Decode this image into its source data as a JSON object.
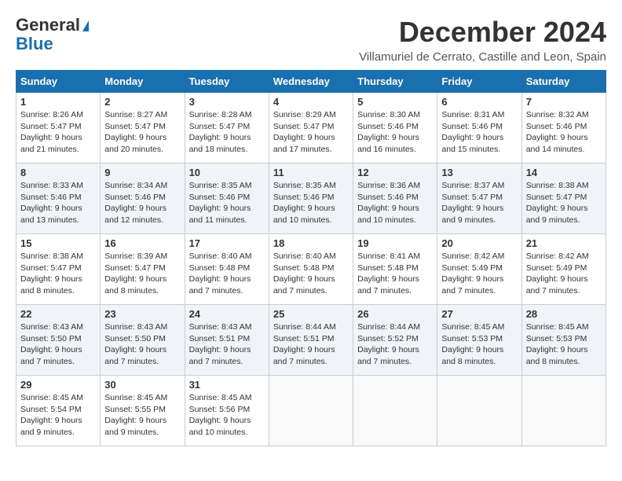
{
  "logo": {
    "line1": "General",
    "line2": "Blue"
  },
  "title": "December 2024",
  "subtitle": "Villamuriel de Cerrato, Castille and Leon, Spain",
  "days_of_week": [
    "Sunday",
    "Monday",
    "Tuesday",
    "Wednesday",
    "Thursday",
    "Friday",
    "Saturday"
  ],
  "weeks": [
    [
      {
        "day": "1",
        "detail": "Sunrise: 8:26 AM\nSunset: 5:47 PM\nDaylight: 9 hours and 21 minutes."
      },
      {
        "day": "2",
        "detail": "Sunrise: 8:27 AM\nSunset: 5:47 PM\nDaylight: 9 hours and 20 minutes."
      },
      {
        "day": "3",
        "detail": "Sunrise: 8:28 AM\nSunset: 5:47 PM\nDaylight: 9 hours and 18 minutes."
      },
      {
        "day": "4",
        "detail": "Sunrise: 8:29 AM\nSunset: 5:47 PM\nDaylight: 9 hours and 17 minutes."
      },
      {
        "day": "5",
        "detail": "Sunrise: 8:30 AM\nSunset: 5:46 PM\nDaylight: 9 hours and 16 minutes."
      },
      {
        "day": "6",
        "detail": "Sunrise: 8:31 AM\nSunset: 5:46 PM\nDaylight: 9 hours and 15 minutes."
      },
      {
        "day": "7",
        "detail": "Sunrise: 8:32 AM\nSunset: 5:46 PM\nDaylight: 9 hours and 14 minutes."
      }
    ],
    [
      {
        "day": "8",
        "detail": "Sunrise: 8:33 AM\nSunset: 5:46 PM\nDaylight: 9 hours and 13 minutes."
      },
      {
        "day": "9",
        "detail": "Sunrise: 8:34 AM\nSunset: 5:46 PM\nDaylight: 9 hours and 12 minutes."
      },
      {
        "day": "10",
        "detail": "Sunrise: 8:35 AM\nSunset: 5:46 PM\nDaylight: 9 hours and 11 minutes."
      },
      {
        "day": "11",
        "detail": "Sunrise: 8:35 AM\nSunset: 5:46 PM\nDaylight: 9 hours and 10 minutes."
      },
      {
        "day": "12",
        "detail": "Sunrise: 8:36 AM\nSunset: 5:46 PM\nDaylight: 9 hours and 10 minutes."
      },
      {
        "day": "13",
        "detail": "Sunrise: 8:37 AM\nSunset: 5:47 PM\nDaylight: 9 hours and 9 minutes."
      },
      {
        "day": "14",
        "detail": "Sunrise: 8:38 AM\nSunset: 5:47 PM\nDaylight: 9 hours and 9 minutes."
      }
    ],
    [
      {
        "day": "15",
        "detail": "Sunrise: 8:38 AM\nSunset: 5:47 PM\nDaylight: 9 hours and 8 minutes."
      },
      {
        "day": "16",
        "detail": "Sunrise: 8:39 AM\nSunset: 5:47 PM\nDaylight: 9 hours and 8 minutes."
      },
      {
        "day": "17",
        "detail": "Sunrise: 8:40 AM\nSunset: 5:48 PM\nDaylight: 9 hours and 7 minutes."
      },
      {
        "day": "18",
        "detail": "Sunrise: 8:40 AM\nSunset: 5:48 PM\nDaylight: 9 hours and 7 minutes."
      },
      {
        "day": "19",
        "detail": "Sunrise: 8:41 AM\nSunset: 5:48 PM\nDaylight: 9 hours and 7 minutes."
      },
      {
        "day": "20",
        "detail": "Sunrise: 8:42 AM\nSunset: 5:49 PM\nDaylight: 9 hours and 7 minutes."
      },
      {
        "day": "21",
        "detail": "Sunrise: 8:42 AM\nSunset: 5:49 PM\nDaylight: 9 hours and 7 minutes."
      }
    ],
    [
      {
        "day": "22",
        "detail": "Sunrise: 8:43 AM\nSunset: 5:50 PM\nDaylight: 9 hours and 7 minutes."
      },
      {
        "day": "23",
        "detail": "Sunrise: 8:43 AM\nSunset: 5:50 PM\nDaylight: 9 hours and 7 minutes."
      },
      {
        "day": "24",
        "detail": "Sunrise: 8:43 AM\nSunset: 5:51 PM\nDaylight: 9 hours and 7 minutes."
      },
      {
        "day": "25",
        "detail": "Sunrise: 8:44 AM\nSunset: 5:51 PM\nDaylight: 9 hours and 7 minutes."
      },
      {
        "day": "26",
        "detail": "Sunrise: 8:44 AM\nSunset: 5:52 PM\nDaylight: 9 hours and 7 minutes."
      },
      {
        "day": "27",
        "detail": "Sunrise: 8:45 AM\nSunset: 5:53 PM\nDaylight: 9 hours and 8 minutes."
      },
      {
        "day": "28",
        "detail": "Sunrise: 8:45 AM\nSunset: 5:53 PM\nDaylight: 9 hours and 8 minutes."
      }
    ],
    [
      {
        "day": "29",
        "detail": "Sunrise: 8:45 AM\nSunset: 5:54 PM\nDaylight: 9 hours and 9 minutes."
      },
      {
        "day": "30",
        "detail": "Sunrise: 8:45 AM\nSunset: 5:55 PM\nDaylight: 9 hours and 9 minutes."
      },
      {
        "day": "31",
        "detail": "Sunrise: 8:45 AM\nSunset: 5:56 PM\nDaylight: 9 hours and 10 minutes."
      },
      {
        "day": "",
        "detail": ""
      },
      {
        "day": "",
        "detail": ""
      },
      {
        "day": "",
        "detail": ""
      },
      {
        "day": "",
        "detail": ""
      }
    ]
  ]
}
